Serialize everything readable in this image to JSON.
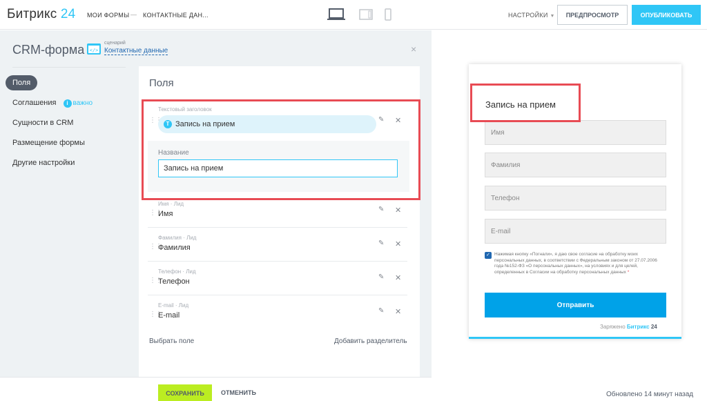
{
  "header": {
    "logo_text": "Битрикс",
    "logo_num": "24",
    "breadcrumb_1": "МОИ ФОРМЫ",
    "breadcrumb_sep": "—",
    "breadcrumb_2": "КОНТАКТНЫЕ ДАН...",
    "settings": "НАСТРОЙКИ",
    "preview_button": "ПРЕДПРОСМОТР",
    "publish_button": "ОПУБЛИКОВАТЬ",
    "devices": [
      "laptop-icon",
      "tablet-icon",
      "phone-icon"
    ]
  },
  "panel": {
    "title": "CRM-форма",
    "scenario_small": "сценарий",
    "scenario_link": "Контактные данные",
    "close": "×"
  },
  "sidebar": {
    "items": [
      {
        "label": "Поля",
        "active": true
      },
      {
        "label": "Соглашения",
        "badge": "i",
        "badge_text": "важно"
      },
      {
        "label": "Сущности в CRM"
      },
      {
        "label": "Размещение формы"
      },
      {
        "label": "Другие настройки"
      }
    ]
  },
  "fields": {
    "title": "Поля",
    "header_field": {
      "small": "Текстовый заголовок",
      "pill_icon": "T",
      "pill_text": "Запись на прием",
      "name_label": "Название",
      "name_value": "Запись на прием"
    },
    "rows": [
      {
        "small": "Имя · Лид",
        "value": "Имя"
      },
      {
        "small": "Фамилия · Лид",
        "value": "Фамилия"
      },
      {
        "small": "Телефон · Лид",
        "value": "Телефон"
      },
      {
        "small": "E-mail · Лид",
        "value": "E-mail"
      }
    ],
    "choose_field": "Выбрать поле",
    "add_separator": "Добавить разделитель"
  },
  "footer": {
    "save": "СОХРАНИТЬ",
    "cancel": "ОТМЕНИТЬ",
    "updated": "Обновлено 14 минут назад"
  },
  "preview": {
    "title": "Запись на прием",
    "inputs": [
      "Имя",
      "Фамилия",
      "Телефон",
      "E-mail"
    ],
    "consent": "Нажимая кнопку «Погнали», я даю свое согласие на обработку моих персональных данных, в соответствии с Федеральным законом от 27.07.2006 года №152-ФЗ «О персональных данных», на условиях и для целей, определенных в Согласии на обработку персональных данных",
    "consent_star": "*",
    "send_button": "Отправить",
    "powered_prefix": "Заряжено",
    "powered_brand": "Битрикс",
    "powered_num": "24"
  },
  "colors": {
    "accent": "#2fc6f6",
    "save_green": "#bbed21",
    "highlight_red": "#e84b54",
    "send_blue": "#00a2e8"
  }
}
